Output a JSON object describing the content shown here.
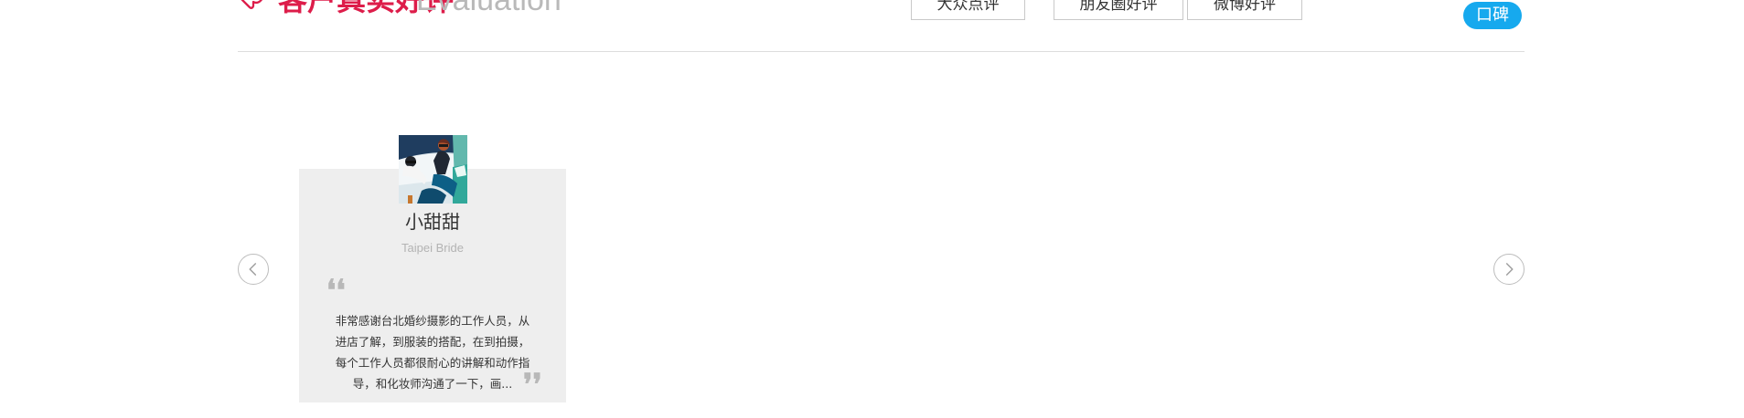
{
  "header": {
    "title_cn": "客户真实好评",
    "title_en": "Evaluation",
    "tabs": [
      {
        "label": "大众点评"
      },
      {
        "label": "朋友圈好评"
      },
      {
        "label": "微博好评"
      }
    ],
    "badge": "口碑"
  },
  "colors": {
    "accent": "#dd1d4a",
    "badge": "#16a9ee",
    "card_background": "#eeeeee"
  },
  "icons": {
    "brand": "heart-chat-icon",
    "previous": "chevron-left-icon",
    "next": "chevron-right-icon",
    "quote_open": "opening-quote-icon",
    "quote_close": "closing-quote-icon"
  },
  "review": {
    "name": "小甜甜",
    "subtitle": "Taipei Bride",
    "quote_open": "❛❛",
    "quote_close": "❜❜",
    "text_lines": [
      "非常感谢台北婚纱摄影的工作人员，从",
      "进店了解，到服装的搭配，在到拍摄，",
      "每个工作人员都很耐心的讲解和动作指",
      "导，和化妆师沟通了一下，画..."
    ]
  }
}
